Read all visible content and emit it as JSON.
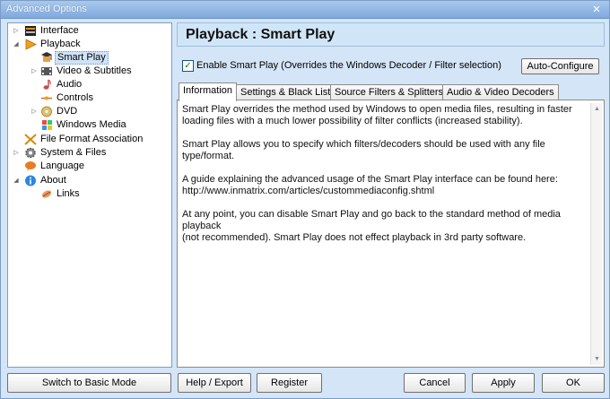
{
  "window": {
    "title": "Advanced Options",
    "close_label": "✕"
  },
  "tree": {
    "items": [
      {
        "label": "Interface",
        "icon": "interface-icon",
        "name": "tree-item-interface"
      },
      {
        "label": "Playback",
        "icon": "playback-icon",
        "name": "tree-item-playback"
      },
      {
        "label": "Smart Play",
        "icon": "smart-play-icon",
        "name": "tree-item-smart-play"
      },
      {
        "label": "Video & Subtitles",
        "icon": "film-icon",
        "name": "tree-item-video-subtitles"
      },
      {
        "label": "Audio",
        "icon": "note-icon",
        "name": "tree-item-audio"
      },
      {
        "label": "Controls",
        "icon": "controls-icon",
        "name": "tree-item-controls"
      },
      {
        "label": "DVD",
        "icon": "dvd-icon",
        "name": "tree-item-dvd"
      },
      {
        "label": "Windows Media",
        "icon": "windows-media-icon",
        "name": "tree-item-windows-media"
      },
      {
        "label": "File Format Association",
        "icon": "file-format-icon",
        "name": "tree-item-file-format"
      },
      {
        "label": "System & Files",
        "icon": "gear-icon",
        "name": "tree-item-system-files"
      },
      {
        "label": "Language",
        "icon": "language-icon",
        "name": "tree-item-language"
      },
      {
        "label": "About",
        "icon": "info-icon",
        "name": "tree-item-about"
      },
      {
        "label": "Links",
        "icon": "link-icon",
        "name": "tree-item-links"
      }
    ]
  },
  "header": {
    "title": "Playback : Smart Play"
  },
  "options": {
    "enable_label": "Enable Smart Play (Overrides the Windows Decoder / Filter selection)",
    "enable_checked": "✓",
    "auto_configure": "Auto-Configure"
  },
  "tabs": [
    {
      "label": "Information"
    },
    {
      "label": "Settings & Black List"
    },
    {
      "label": "Source Filters & Splitters"
    },
    {
      "label": "Audio & Video Decoders"
    }
  ],
  "content": {
    "paragraphs": [
      "Smart Play overrides the method used by Windows to open media files, resulting in faster\nloading files with a much lower possibility of filter conflicts (increased stability).",
      "Smart Play allows you to specify which filters/decoders should be used with any file type/format.",
      "A guide explaining the advanced usage of the Smart Play interface can be found here:\nhttp://www.inmatrix.com/articles/custommediaconfig.shtml",
      "At any point, you can disable Smart Play and go back to the standard method of media playback\n(not recommended). Smart Play does not effect playback in 3rd party software."
    ]
  },
  "buttons": {
    "basic_mode": "Switch to Basic Mode",
    "help_export": "Help / Export",
    "register": "Register",
    "cancel": "Cancel",
    "apply": "Apply",
    "ok": "OK"
  }
}
